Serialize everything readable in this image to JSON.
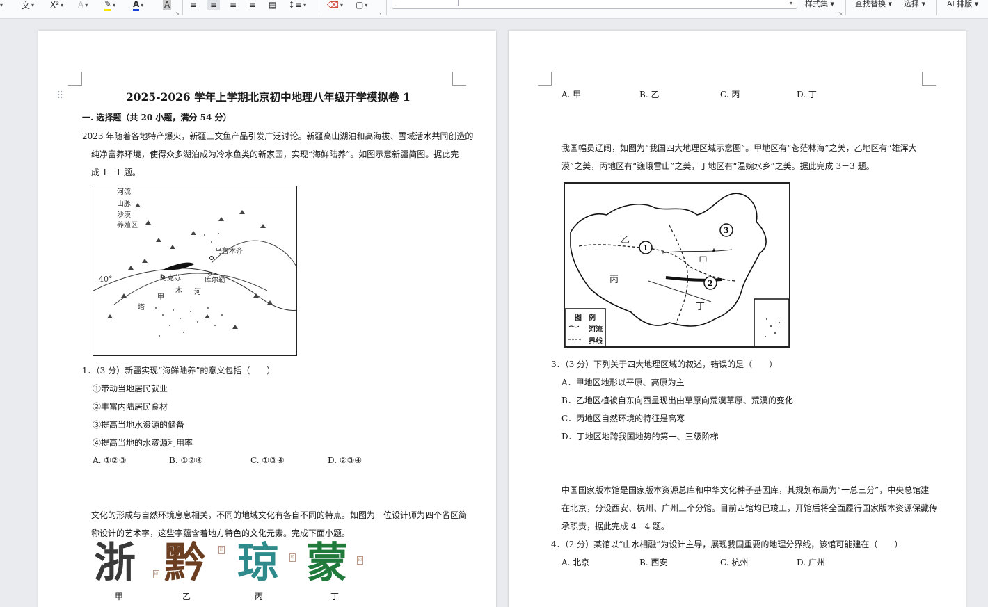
{
  "toolbar": {
    "styles_label": "样式集",
    "find_replace_label": "查找替换",
    "select_label": "选择",
    "ai_layout_label": "AI 排版",
    "icons": [
      "font-size-icon",
      "phonetic-guide-icon",
      "superscript-icon",
      "text-effect-icon",
      "highlight-icon",
      "font-color-icon",
      "char-shading-icon",
      "align-left-icon",
      "align-center-icon",
      "align-right-icon",
      "justify-icon",
      "distributed-icon",
      "line-spacing-icon",
      "clear-format-icon",
      "border-icon"
    ]
  },
  "doc": {
    "title": "2025-2026 学年上学期北京初中地理八年级开学模拟卷 1",
    "section1": "一. 选择题（共 20 小题，满分 54 分）",
    "intro1": [
      "2023 年随着各地特产爆火，新疆三文鱼产品引发广泛讨论。新疆高山湖泊和高海拔、雪域活水共同创造的",
      "纯净富养环境，使得众多湖泊成为冷水鱼类的新家园，实现“海鲜陆养”。如图示意新疆简图。据此完",
      "成 1－1 题。"
    ],
    "map1": {
      "legend": [
        "河流",
        "山脉",
        "沙漠",
        "养殖区"
      ],
      "labels": {
        "urumqi": "乌鲁木齐",
        "aksu": "阿克苏",
        "korla": "库尔勒",
        "lat": "40°",
        "river1": "木",
        "river2": "河",
        "jia": "甲",
        "ta": "塔"
      }
    },
    "q1": {
      "stem": "1．（3 分）新疆实现“海鲜陆养”的意义包括（　　）",
      "items": [
        "①带动当地居民就业",
        "②丰富内陆居民食材",
        "③提高当地水资源的储备",
        "④提高当地的水资源利用率"
      ],
      "options": [
        "A. ①②③",
        "B. ①②④",
        "C. ①③④",
        "D. ②③④"
      ]
    },
    "intro2": [
      "文化的形成与自然环境息息相关，不同的地域文化有各自不同的特点。如图为一位设计师为四个省区简",
      "称设计的艺术字，这些字蕴含着地方特色的文化元素。完成下面小题。"
    ],
    "art": {
      "chars": [
        "浙",
        "黔",
        "琼",
        "蒙"
      ],
      "captions": [
        "甲",
        "乙",
        "丙",
        "丁"
      ],
      "colors": [
        "#3a3a3a",
        "#6b3e22",
        "#2f8a8c",
        "#1f7a3c"
      ]
    },
    "right": {
      "prev_options": [
        "A. 甲",
        "B. 乙",
        "C. 丙",
        "D. 丁"
      ],
      "intro3": [
        "我国幅员辽阔，如图为“我国四大地理区域示意图”。甲地区有“苍茫林海”之美，乙地区有“雄浑大",
        "漠”之美，丙地区有“巍峨雪山”之美，丁地区有“温婉水乡”之美。据此完成 3－3 题。"
      ],
      "map2": {
        "regions": {
          "yi": "乙",
          "jia": "甲",
          "bing": "丙",
          "ding": "丁"
        },
        "nums": [
          "1",
          "2",
          "3"
        ],
        "legend_title": "图　例",
        "legend": [
          "河流",
          "界线"
        ]
      },
      "q3": {
        "stem": "3．（3 分）下列关于四大地理区域的叙述，错误的是（　　）",
        "options": [
          "A．甲地区地形以平原、高原为主",
          "B．乙地区植被自东向西呈现出由草原向荒漠草原、荒漠的变化",
          "C．丙地区自然环境的特征是高寒",
          "D．丁地区地跨我国地势的第一、三级阶梯"
        ]
      },
      "intro4": [
        "中国国家版本馆是国家版本资源总库和中华文化种子基因库，其规划布局为“一总三分”，中央总馆建",
        "在北京，分设西安、杭州、广州三个分馆。目前四馆均已竣工，开馆后将全面履行国家版本资源保藏传",
        "承职责，据此完成 4－4 题。"
      ],
      "q4": {
        "stem": "4．（2 分）某馆以“山水相融”为设计主导，展现我国重要的地理分界线，该馆可能建在（　　）",
        "options": [
          "A. 北京",
          "B. 西安",
          "C. 杭州",
          "D. 广州"
        ]
      }
    }
  }
}
